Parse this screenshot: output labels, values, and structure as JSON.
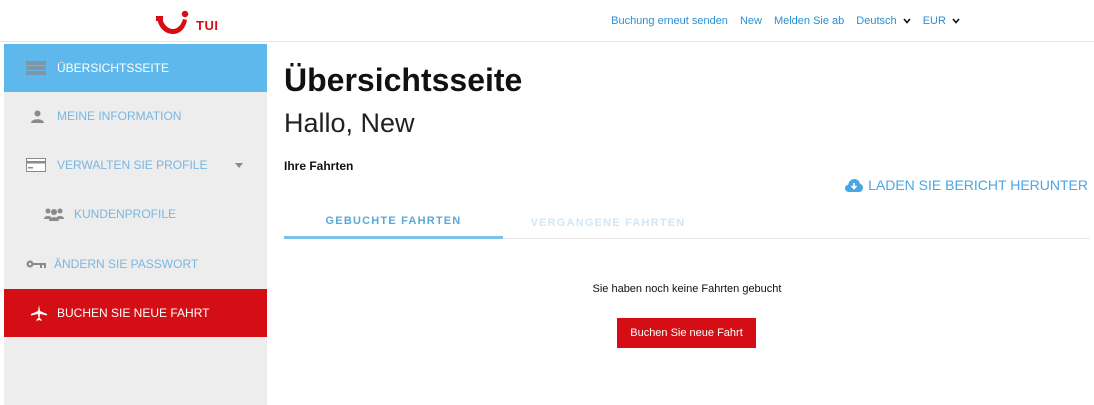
{
  "header": {
    "logo_text": "TUI",
    "nav": {
      "resend": "Buchung erneut senden",
      "user": "New",
      "logout": "Melden Sie ab",
      "language": "Deutsch",
      "currency": "EUR"
    }
  },
  "sidebar": {
    "items": [
      {
        "label": "ÜBERSICHTSSEITE",
        "icon": "overview-icon",
        "state": "active"
      },
      {
        "label": "MEINE INFORMATION",
        "icon": "person-icon"
      },
      {
        "label": "VERWALTEN SIE PROFILE",
        "icon": "card-icon"
      },
      {
        "label": "KUNDENPROFILE",
        "icon": "group-icon"
      },
      {
        "label": "ÄNDERN SIE PASSWORT",
        "icon": "key-icon"
      },
      {
        "label": "BUCHEN SIE NEUE FAHRT",
        "icon": "plane-icon"
      }
    ]
  },
  "main": {
    "title": "Übersichtsseite",
    "greeting": "Hallo, New",
    "trips_heading": "Ihre Fahrten",
    "download_label": "LADEN SIE BERICHT HERUNTER",
    "tabs": [
      {
        "label": "GEBUCHTE FAHRTEN",
        "active": true
      },
      {
        "label": "VERGANGENE FAHRTEN",
        "active": false
      }
    ],
    "empty_text": "Sie haben noch keine Fahrten gebucht",
    "book_button": "Buchen Sie neue Fahrt"
  },
  "colors": {
    "brand_red": "#d40e14",
    "active_blue": "#5fb8ec",
    "link_blue": "#2a8fd4",
    "sidebar_bg": "#ededed"
  }
}
